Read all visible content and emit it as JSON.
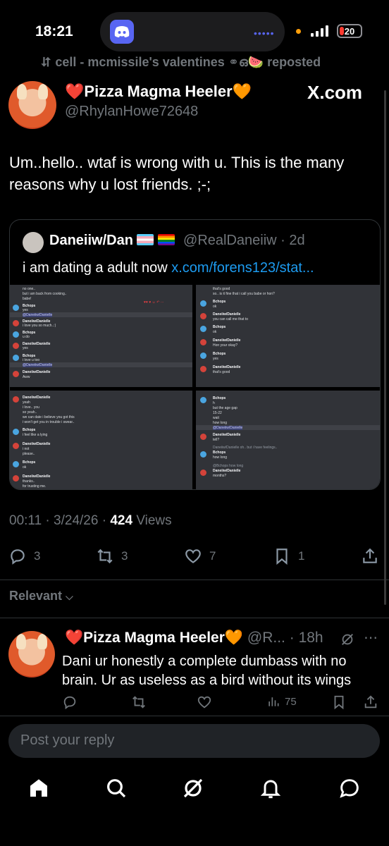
{
  "status_bar": {
    "time": "18:21",
    "battery": "20",
    "battery_level": 0.2,
    "island_app_icon": "discord-icon"
  },
  "repost": {
    "text": "cell - mcmissile's valentines ⚭ഒ🍉 reposted"
  },
  "post": {
    "author": "❤️Pizza Magma Heeler🧡",
    "handle": "@RhylanHowe72648",
    "source_badge": "X.com",
    "text": "Um..hello.. wtaf is wrong with u. This is the many reasons why u lost friends. ;-;",
    "time": "00:11",
    "date": "3/24/26",
    "views_count": "424",
    "views_label": "Views",
    "replies": "3",
    "reposts": "3",
    "likes": "7",
    "bookmarks": "1"
  },
  "quote": {
    "author": "Daneiiw/Dan",
    "handle": "@RealDaneiiw",
    "age": "2d",
    "text": "i am dating a adult now ",
    "link": "x.com/forens123/stat..."
  },
  "screenshots": {
    "s1": {
      "messages": [
        "no one..",
        "but i am back from cooking..",
        "babe!",
        "Bchops",
        "yes",
        "@Daneiiw/Danielle",
        "Daneiiw/Danielle",
        "i love you so much..:)",
        "Bchops",
        "u do",
        "Daneiiw/Danielle",
        "yes",
        "Bchops",
        "i love u too",
        "@Daneiiw/Danielle",
        "Daneiiw/Danielle",
        "Aww"
      ]
    },
    "s2": {
      "messages": [
        "that's good",
        "so.. is it fine that i call you babe or hon?",
        "Bchops",
        "ok",
        "Daneiiw/Danielle",
        "you can call me that to",
        "Bchops",
        "ok",
        "Daneiiw/Danielle",
        "Hon your okay?",
        "Bchops",
        "yes",
        "Daneiiw/Danielle",
        "that's good"
      ]
    },
    "s3": {
      "messages": [
        "Daneiiw/Danielle",
        "yeah",
        "i love.. you",
        "so yeah..",
        "we can date i believe you got this",
        "i won't get you in trouble i swear..",
        "Bchops",
        "i feel like a lying",
        "Daneiiw/Danielle",
        "i not",
        "please..",
        "Bchops",
        "ok",
        "Daneiiw/Danielle",
        "thanks..",
        "for trusting me."
      ]
    },
    "s4": {
      "messages": [
        "Bchops",
        "h",
        "but the age gap",
        "15-22",
        "wait",
        "how long",
        "@Daneiiw/Danielle",
        "Daneiiw/Danielle",
        "tell?",
        "Daneiiw/Danielle oh.. but i have feelings..",
        "Bchops",
        "how long",
        "@Bchops how long",
        "Daneiiw/Danielle",
        "months?"
      ]
    }
  },
  "sort": {
    "label": "Relevant"
  },
  "reply": {
    "author": "❤️Pizza Magma Heeler🧡",
    "handle": "@R...",
    "age": "18h",
    "text": "Dani ur honestly a complete dumbass with no brain. Ur as useless as a bird without its wings",
    "views": "75"
  },
  "composer": {
    "placeholder": "Post your reply"
  },
  "nav": {
    "items": [
      "home-icon",
      "search-icon",
      "grok-icon",
      "notifications-icon",
      "messages-icon"
    ]
  },
  "colors": {
    "background": "#000000",
    "text": "#e7e9ea",
    "muted": "#71767b",
    "link": "#1d9bf0",
    "border": "#2f3336",
    "discord": "#5865f2"
  }
}
